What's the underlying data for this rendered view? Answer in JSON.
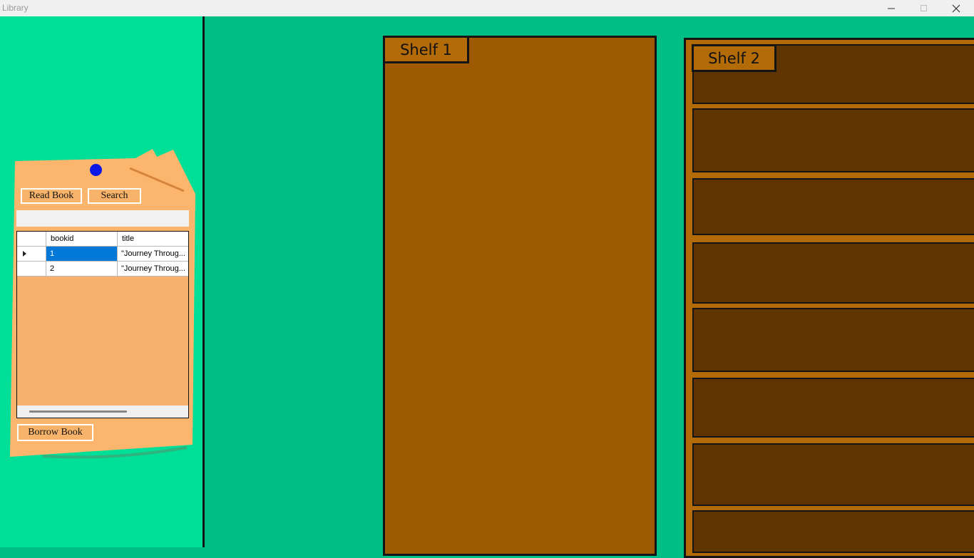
{
  "window": {
    "title": "Library"
  },
  "controls": {
    "minimize": "minimize-icon",
    "maximize": "maximize-icon",
    "close": "close-icon"
  },
  "panel": {
    "read_label": "Read Book",
    "search_label": "Search",
    "search_value": "",
    "borrow_label": "Borrow Book",
    "grid": {
      "columns": [
        "bookid",
        "title"
      ],
      "rows": [
        {
          "bookid": "1",
          "title": "\"Journey Throug...",
          "selected": true
        },
        {
          "bookid": "2",
          "title": "\"Journey Throug...",
          "selected": false
        }
      ]
    }
  },
  "shelves": [
    {
      "label": "Shelf 1"
    },
    {
      "label": "Shelf 2"
    }
  ],
  "colors": {
    "left_panel": "#00df97",
    "main_bg": "#00bf84",
    "paper": "#fbb56c",
    "pin": "#0a19e6",
    "shelf1": "#9e5a00",
    "shelf2_board": "#603400",
    "selection": "#0078d7"
  }
}
